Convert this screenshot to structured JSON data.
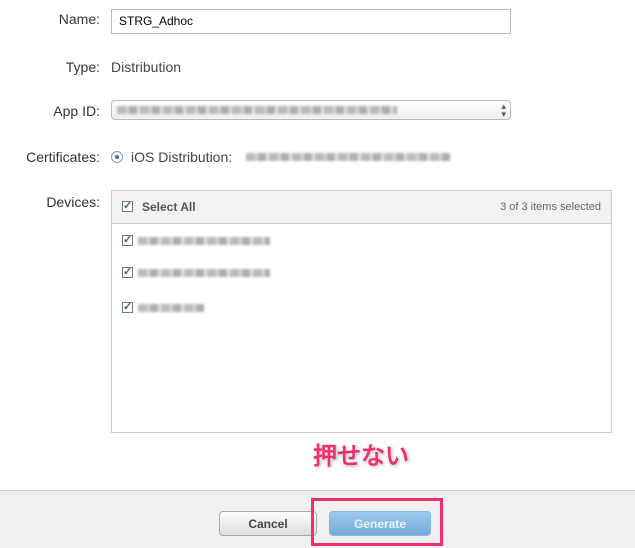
{
  "form": {
    "name_label": "Name:",
    "name_value": "STRG_Adhoc",
    "type_label": "Type:",
    "type_value": "Distribution",
    "appid_label": "App ID:",
    "certificates_label": "Certificates:",
    "certificate_prefix": "iOS Distribution:",
    "devices_label": "Devices:"
  },
  "devices": {
    "select_all": "Select All",
    "selected_count": "3 of 3 items selected",
    "items_checked": [
      true,
      true,
      true
    ]
  },
  "footer": {
    "cancel": "Cancel",
    "generate": "Generate"
  },
  "annotation": {
    "text": "押せない",
    "color": "#f0306e"
  },
  "colors": {
    "accent": "#74acd9",
    "highlight": "#f0306e"
  }
}
